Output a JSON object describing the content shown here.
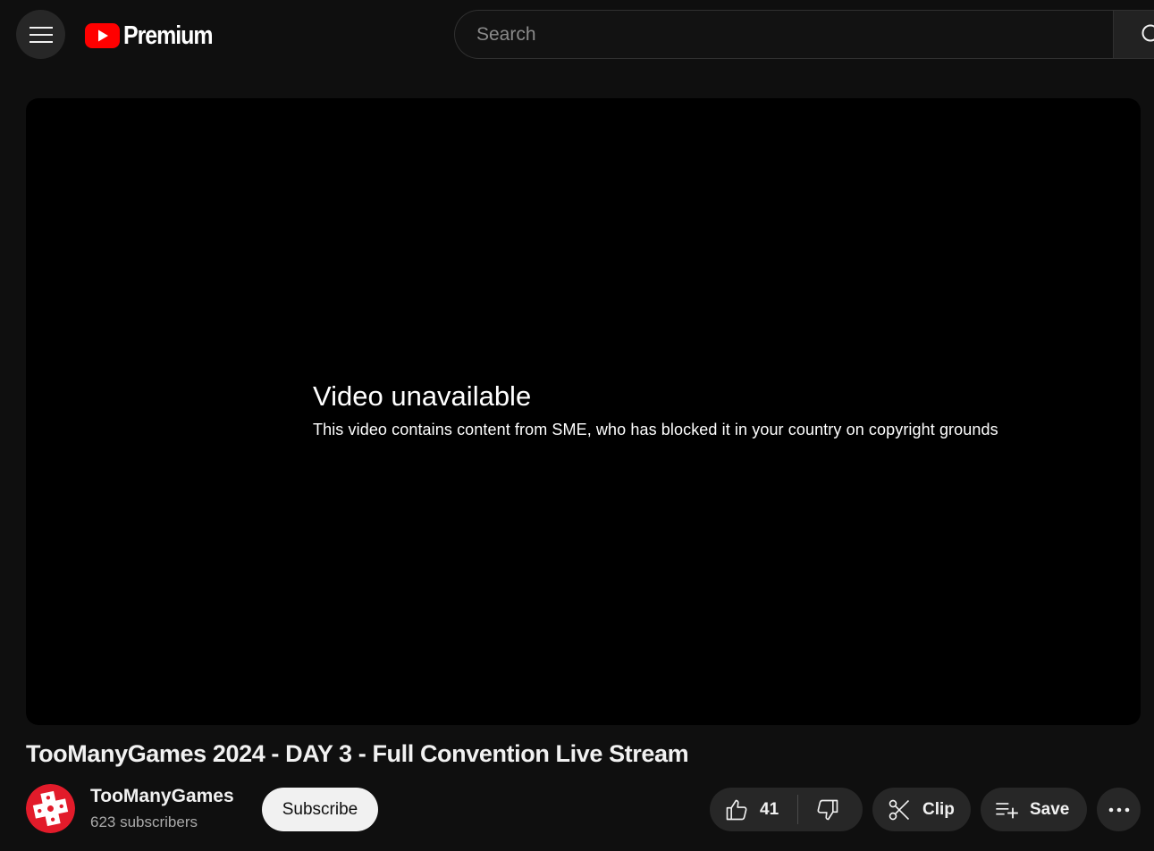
{
  "header": {
    "logo_text": "Premium",
    "search_placeholder": "Search"
  },
  "player": {
    "error_title": "Video unavailable",
    "error_message": "This video contains content from SME, who has blocked it in your country on copyright grounds"
  },
  "video": {
    "title": "TooManyGames 2024 - DAY 3 - Full Convention Live Stream"
  },
  "channel": {
    "name": "TooManyGames",
    "subscribers": "623 subscribers",
    "subscribe_label": "Subscribe"
  },
  "actions": {
    "like_count": "41",
    "clip_label": "Clip",
    "save_label": "Save"
  },
  "colors": {
    "background": "#0f0f0f",
    "youtube_red": "#ff0000",
    "button_bg": "#272727",
    "subscribe_bg": "#f1f1f1"
  },
  "icons": {
    "menu": "hamburger-icon",
    "logo": "youtube-play-icon",
    "search": "search-icon",
    "like": "thumbs-up-icon",
    "dislike": "thumbs-down-icon",
    "clip": "scissors-icon",
    "save": "playlist-add-icon",
    "more": "more-horizontal-icon"
  }
}
